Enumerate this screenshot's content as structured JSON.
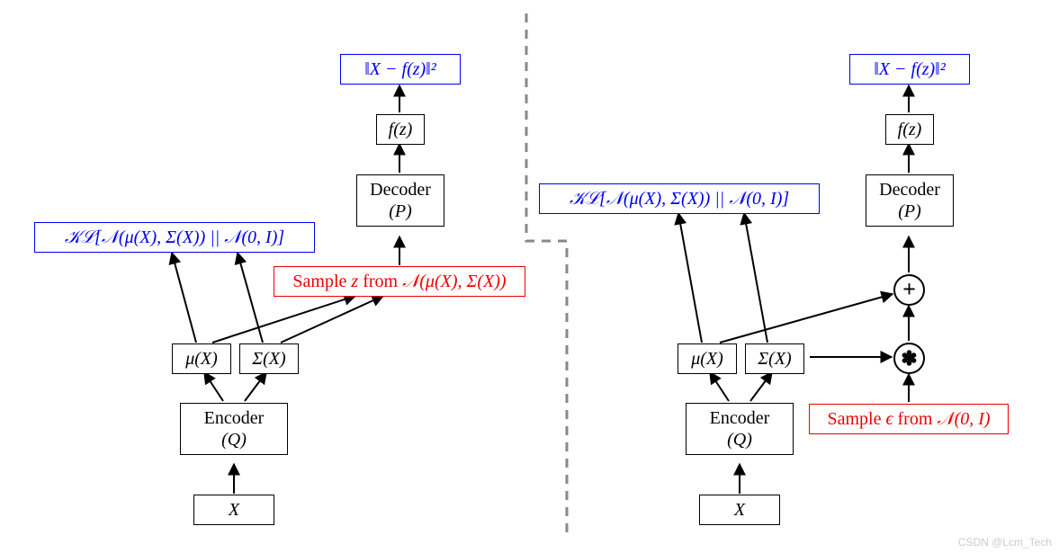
{
  "left": {
    "input": "X",
    "encoder_line1": "Encoder",
    "encoder_line2": "(Q)",
    "mu": "μ(X)",
    "sigma": "Σ(X)",
    "kl": "𝒦ℒ[𝒩(μ(X), Σ(X)) || 𝒩(0, I)]",
    "sample_prefix": "Sample ",
    "sample_var": "z",
    "sample_mid": " from ",
    "sample_dist": "𝒩(μ(X), Σ(X))",
    "decoder_line1": "Decoder",
    "decoder_line2": "(P)",
    "fz": "f(z)",
    "loss": "‖X − f(z)‖²"
  },
  "right": {
    "input": "X",
    "encoder_line1": "Encoder",
    "encoder_line2": "(Q)",
    "mu": "μ(X)",
    "sigma": "Σ(X)",
    "kl": "𝒦ℒ[𝒩(μ(X), Σ(X)) || 𝒩(0, I)]",
    "sample_prefix": "Sample ",
    "sample_var": "ϵ",
    "sample_mid": " from ",
    "sample_dist": "𝒩(0, I)",
    "mul": "✽",
    "add": "+",
    "decoder_line1": "Decoder",
    "decoder_line2": "(P)",
    "fz": "f(z)",
    "loss": "‖X − f(z)‖²"
  },
  "watermark": "CSDN @Lcm_Tech"
}
